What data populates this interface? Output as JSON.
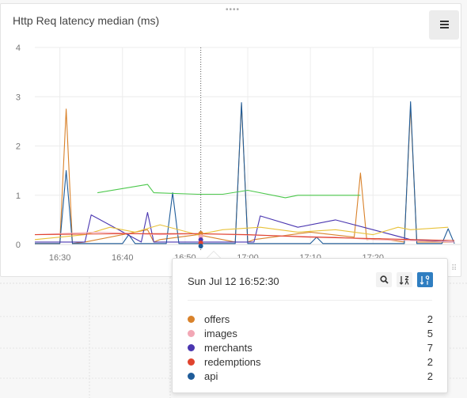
{
  "panel": {
    "title": "Http Req latency median (ms)"
  },
  "icons": {
    "drag": "drag-handle-icon",
    "menu": "hamburger-menu-icon",
    "search": "search-icon",
    "sort_alpha": "sort-alpha-icon",
    "sort_numeric": "sort-numeric-icon",
    "resize": "resize-handle-icon"
  },
  "colors": {
    "accent": "#2f7ec1",
    "green_series": "#4cc84c"
  },
  "tooltip": {
    "time": "Sun Jul 12 16:52:30",
    "items": [
      {
        "name": "offers",
        "value": "2",
        "color": "#d9822b"
      },
      {
        "name": "images",
        "value": "5",
        "color": "#f2a7b5"
      },
      {
        "name": "merchants",
        "value": "7",
        "color": "#4a36b0"
      },
      {
        "name": "redemptions",
        "value": "2",
        "color": "#e0432e"
      },
      {
        "name": "api",
        "value": "2",
        "color": "#1f5c99"
      }
    ]
  },
  "chart_data": {
    "type": "line",
    "title": "Http Req latency median (ms)",
    "ylim": [
      0,
      4
    ],
    "yticks": [
      "0",
      "1",
      "2",
      "3",
      "4"
    ],
    "xlim": [
      "16:26",
      "17:34"
    ],
    "xticks": [
      "16:30",
      "16:40",
      "16:50",
      "17:00",
      "17:10",
      "17:20"
    ],
    "grid": true,
    "cursor_time": "16:52:30",
    "series": [
      {
        "color": "#d9822b",
        "x": [
          "16:26",
          "16:30",
          "16:31",
          "16:32",
          "16:34",
          "16:44",
          "16:45",
          "16:46",
          "16:52",
          "16:58",
          "16:59",
          "17:00",
          "17:01",
          "17:10",
          "17:17",
          "17:18",
          "17:19",
          "17:21",
          "17:25",
          "17:26",
          "17:27",
          "17:33"
        ],
        "y": [
          0.02,
          0.02,
          2.75,
          0.02,
          0.05,
          0.3,
          0.05,
          0.1,
          0.2,
          0.05,
          2.85,
          0.05,
          0.1,
          0.25,
          0.15,
          1.45,
          0.1,
          0.12,
          0.05,
          2.8,
          0.05,
          0.05
        ]
      },
      {
        "color": "#1f5c99",
        "x": [
          "16:26",
          "16:30",
          "16:31",
          "16:32",
          "16:40",
          "16:41",
          "16:42",
          "16:47",
          "16:48",
          "16:49",
          "16:58",
          "16:59",
          "17:00",
          "17:10",
          "17:11",
          "17:12",
          "17:25",
          "17:26",
          "17:27",
          "17:31",
          "17:32",
          "17:33"
        ],
        "y": [
          0.02,
          0.02,
          1.5,
          0.02,
          0.02,
          0.2,
          0.02,
          0.02,
          1.05,
          0.02,
          0.02,
          2.88,
          0.02,
          0.02,
          0.15,
          0.02,
          0.02,
          2.9,
          0.02,
          0.02,
          0.32,
          0.02
        ]
      },
      {
        "color": "#4a36b0",
        "x": [
          "16:26",
          "16:34",
          "16:35",
          "16:43",
          "16:44",
          "16:45",
          "16:55",
          "17:01",
          "17:02",
          "17:08",
          "17:14",
          "17:20",
          "17:26",
          "17:33"
        ],
        "y": [
          0.05,
          0.05,
          0.6,
          0.05,
          0.65,
          0.05,
          0.05,
          0.05,
          0.58,
          0.35,
          0.5,
          0.3,
          0.1,
          0.05
        ]
      },
      {
        "color": "#4cc84c",
        "x": [
          "16:36",
          "16:44",
          "16:45",
          "16:52",
          "16:56",
          "17:00",
          "17:06",
          "17:08",
          "17:14",
          "17:18"
        ],
        "y": [
          1.05,
          1.22,
          1.05,
          1.02,
          1.02,
          1.1,
          0.95,
          1.0,
          1.0,
          1.0
        ]
      },
      {
        "color": "#e8c23a",
        "x": [
          "16:26",
          "16:34",
          "16:38",
          "16:42",
          "16:46",
          "16:52",
          "16:56",
          "17:02",
          "17:08",
          "17:14",
          "17:20",
          "17:24",
          "17:26",
          "17:32"
        ],
        "y": [
          0.1,
          0.2,
          0.35,
          0.25,
          0.4,
          0.2,
          0.3,
          0.35,
          0.25,
          0.3,
          0.2,
          0.35,
          0.3,
          0.35
        ]
      },
      {
        "color": "#f2a7b5",
        "x": [
          "16:26",
          "16:36",
          "16:46",
          "16:52",
          "16:58",
          "17:04",
          "17:14",
          "17:20",
          "17:26",
          "17:33"
        ],
        "y": [
          0.2,
          0.25,
          0.2,
          0.22,
          0.2,
          0.18,
          0.15,
          0.1,
          0.08,
          0.05
        ]
      },
      {
        "color": "#e0432e",
        "x": [
          "16:26",
          "16:40",
          "16:52",
          "17:00",
          "17:10",
          "17:33"
        ],
        "y": [
          0.2,
          0.22,
          0.22,
          0.2,
          0.15,
          0.08
        ]
      }
    ]
  }
}
